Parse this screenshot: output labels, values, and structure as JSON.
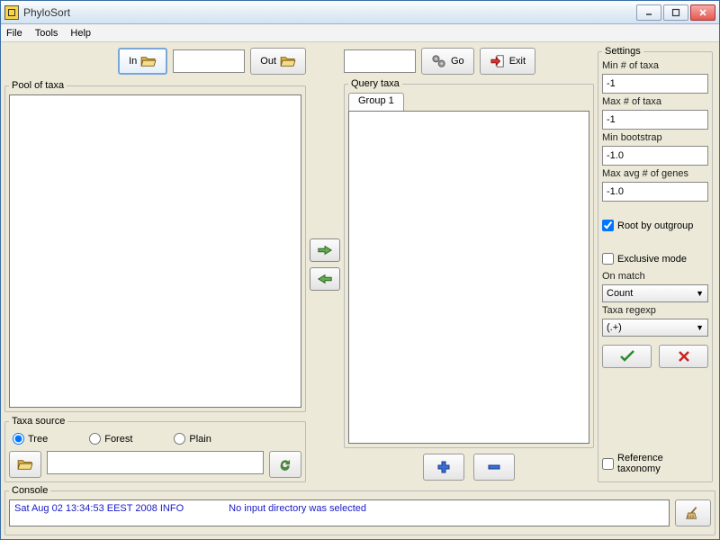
{
  "window": {
    "title": "PhyloSort"
  },
  "menu": {
    "file": "File",
    "tools": "Tools",
    "help": "Help"
  },
  "toolbar": {
    "in_label": "In",
    "out_label": "Out",
    "go_label": "Go",
    "exit_label": "Exit"
  },
  "pool": {
    "legend": "Pool of taxa"
  },
  "taxa_source": {
    "legend": "Taxa source",
    "options": {
      "tree": "Tree",
      "forest": "Forest",
      "plain": "Plain"
    },
    "selected": "tree"
  },
  "query": {
    "legend": "Query taxa",
    "tabs": [
      "Group 1"
    ]
  },
  "settings": {
    "legend": "Settings",
    "min_taxa_label": "Min # of taxa",
    "min_taxa_value": "-1",
    "max_taxa_label": "Max # of taxa",
    "max_taxa_value": "-1",
    "min_bootstrap_label": "Min bootstrap",
    "min_bootstrap_value": "-1.0",
    "max_genes_label": "Max avg # of genes",
    "max_genes_value": "-1.0",
    "root_outgroup_label": "Root by outgroup",
    "root_outgroup_checked": true,
    "exclusive_label": "Exclusive mode",
    "exclusive_checked": false,
    "on_match_label": "On match",
    "on_match_value": "Count",
    "taxa_regexp_label": "Taxa regexp",
    "taxa_regexp_value": "(.+)",
    "reference_tax_label": "Reference taxonomy",
    "reference_tax_checked": false
  },
  "console": {
    "legend": "Console",
    "timestamp": "Sat Aug 02 13:34:53 EEST 2008 INFO",
    "message": "No input directory was selected"
  }
}
